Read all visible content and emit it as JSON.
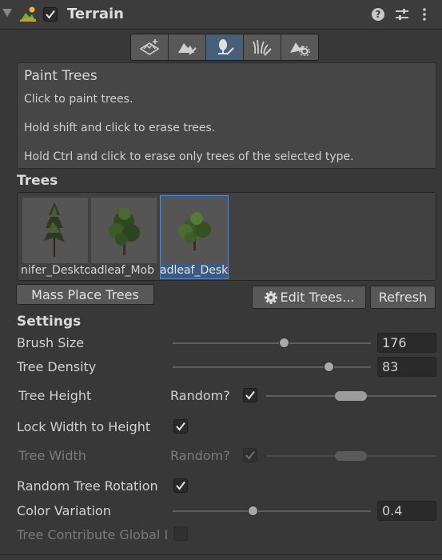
{
  "header": {
    "title": "Terrain",
    "enabled": true
  },
  "toolbar": {
    "tools": [
      {
        "name": "create-neighbor-terrains",
        "icon": "terrain-plus-icon",
        "active": false
      },
      {
        "name": "paint-terrain",
        "icon": "terrain-brush-icon",
        "active": false
      },
      {
        "name": "paint-trees",
        "icon": "tree-brush-icon",
        "active": true
      },
      {
        "name": "paint-details",
        "icon": "grass-brush-icon",
        "active": false
      },
      {
        "name": "terrain-settings",
        "icon": "terrain-gear-icon",
        "active": false
      }
    ]
  },
  "help": {
    "title": "Paint Trees",
    "line1": "Click to paint trees.",
    "line2": "Hold shift and click to erase trees.",
    "line3": "Hold Ctrl and click to erase only trees of the selected type."
  },
  "trees": {
    "heading": "Trees",
    "items": [
      {
        "name": "nifer_Deskto",
        "selected": false
      },
      {
        "name": "adleaf_Mob",
        "selected": false
      },
      {
        "name": "adleaf_Desk",
        "selected": true
      }
    ]
  },
  "buttons": {
    "mass_place": "Mass Place Trees",
    "edit_trees": "Edit Trees...",
    "refresh": "Refresh"
  },
  "settings": {
    "heading": "Settings",
    "brush_size": {
      "label": "Brush Size",
      "value": "176",
      "fraction": 0.5
    },
    "tree_density": {
      "label": "Tree Density",
      "value": "83",
      "fraction": 0.76
    },
    "tree_height": {
      "label": "Tree Height",
      "random_label": "Random?",
      "random": true
    },
    "lock_width": {
      "label": "Lock Width to Height",
      "checked": true
    },
    "tree_width": {
      "label": "Tree Width",
      "random_label": "Random?",
      "random": true
    },
    "random_rotation": {
      "label": "Random Tree Rotation",
      "checked": true
    },
    "color_variation": {
      "label": "Color Variation",
      "value": "0.4",
      "fraction": 0.4
    },
    "tree_contribute": {
      "label": "Tree Contribute Global Illumination",
      "checked": false
    }
  },
  "colors": {
    "accent": "#46607c",
    "background": "#383838"
  }
}
